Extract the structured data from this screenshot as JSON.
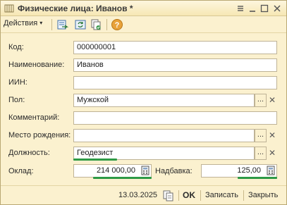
{
  "window": {
    "title": "Физические лица: Иванов *"
  },
  "toolbar": {
    "actions_label": "Действия",
    "actions_arrow": "▾",
    "icons": [
      "save-to-list-icon",
      "refresh-icon",
      "copy-icon",
      "help-icon"
    ],
    "help_glyph": "?"
  },
  "form": {
    "code": {
      "label": "Код:",
      "value": "000000001"
    },
    "name": {
      "label": "Наименование:",
      "value": "Иванов"
    },
    "iin": {
      "label": "ИИН:",
      "value": ""
    },
    "gender": {
      "label": "Пол:",
      "value": "Мужской"
    },
    "comment": {
      "label": "Комментарий:",
      "value": ""
    },
    "birthplace": {
      "label": "Место рождения:",
      "value": ""
    },
    "position": {
      "label": "Должность:",
      "value": "Геодезист"
    },
    "salary": {
      "label": "Оклад:",
      "value": "214 000,00"
    },
    "bonus": {
      "label": "Надбавка:",
      "value": "125,00"
    },
    "select_glyph": "...",
    "clear_glyph": "✕"
  },
  "footer": {
    "date": "13.03.2025",
    "ok_label": "OK",
    "save_label": "Записать",
    "close_label": "Закрыть"
  },
  "colors": {
    "window_bg": "#fbf1cf",
    "highlight": "#2e9a46",
    "help_icon": "#e8a23a"
  }
}
